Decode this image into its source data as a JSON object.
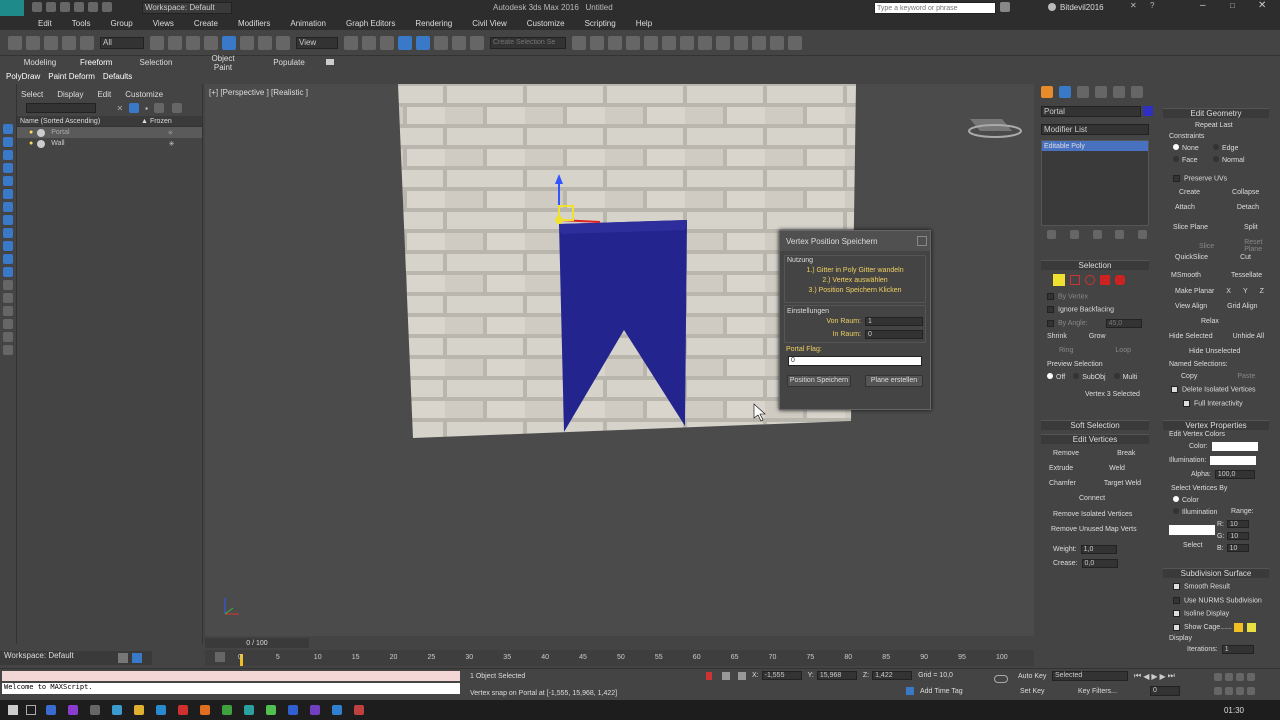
{
  "title_bar": {
    "workspace": "Workspace: Default",
    "app_title": "Autodesk 3ds Max 2016",
    "doc_title": "Untitled",
    "search_placeholder": "Type a keyword or phrase",
    "user": "Bitdevil2016"
  },
  "menu": [
    "Edit",
    "Tools",
    "Group",
    "Views",
    "Create",
    "Modifiers",
    "Animation",
    "Graph Editors",
    "Rendering",
    "Civil View",
    "Customize",
    "Scripting",
    "Help"
  ],
  "toolbar": {
    "filter_value": "All",
    "refcoord_value": "View",
    "selection_set_placeholder": "Create Selection Se"
  },
  "ribbon": {
    "tabs": [
      "Modeling",
      "Freeform",
      "Selection",
      "Object Paint",
      "Populate"
    ],
    "subtabs": [
      "PolyDraw",
      "Paint Deform",
      "Defaults"
    ]
  },
  "scene_explorer": {
    "menu": [
      "Select",
      "Display",
      "Edit",
      "Customize"
    ],
    "col_name": "Name (Sorted Ascending)",
    "col_frozen": "Frozen",
    "items": [
      {
        "name": "Portal",
        "selected": true
      },
      {
        "name": "Wall",
        "selected": false
      }
    ]
  },
  "viewport": {
    "label": "[+] [Perspective ] [Realistic ]"
  },
  "dialog": {
    "title": "Vertex Position Speichern",
    "group1": "Nutzung",
    "steps": [
      "1.) Gitter in Poly Gitter wandeln",
      "2.) Vertex auswählen",
      "3.) Position Speichern Klicken"
    ],
    "group2": "Einstellungen",
    "von_raum_label": "Von Raum:",
    "von_raum_value": "1",
    "in_raum_label": "In Raum:",
    "in_raum_value": "0",
    "portal_flag_label": "Portal Flag:",
    "portal_flag_value": "0",
    "btn_save": "Position Speichern",
    "btn_plane": "Plane erstellen"
  },
  "command_panel": {
    "object_name": "Portal",
    "modifier_list": "Modifier List",
    "stack_item": "Editable Poly",
    "selection_title": "Selection",
    "by_vertex": "By Vertex",
    "ignore_backfacing": "Ignore Backfacing",
    "by_angle": "By Angle:",
    "by_angle_value": "45,0",
    "shrink": "Shrink",
    "grow": "Grow",
    "ring": "Ring",
    "loop": "Loop",
    "preview_selection": "Preview Selection",
    "preview_opts": [
      "Off",
      "SubObj",
      "Multi"
    ],
    "selected_status": "Vertex 3 Selected",
    "soft_selection": "Soft Selection",
    "edit_vertices": "Edit Vertices",
    "remove": "Remove",
    "break": "Break",
    "extrude": "Extrude",
    "weld": "Weld",
    "chamfer": "Chamfer",
    "target_weld": "Target Weld",
    "connect": "Connect",
    "remove_isolated": "Remove Isolated Vertices",
    "remove_unused": "Remove Unused Map Verts",
    "weight_label": "Weight:",
    "weight_value": "1,0",
    "crease_label": "Crease:",
    "crease_value": "0,0"
  },
  "right_panel": {
    "edit_geometry": "Edit Geometry",
    "repeat_last": "Repeat Last",
    "constraints": "Constraints",
    "constraint_opts": [
      "None",
      "Edge",
      "Face",
      "Normal"
    ],
    "preserve_uvs": "Preserve UVs",
    "create": "Create",
    "collapse": "Collapse",
    "attach": "Attach",
    "detach": "Detach",
    "slice_plane": "Slice Plane",
    "split": "Split",
    "slice": "Slice",
    "reset_plane": "Reset Plane",
    "quickslice": "QuickSlice",
    "cut": "Cut",
    "msmooth": "MSmooth",
    "tessellate": "Tessellate",
    "make_planar": "Make Planar",
    "xyz": [
      "X",
      "Y",
      "Z"
    ],
    "view_align": "View Align",
    "grid_align": "Grid Align",
    "relax": "Relax",
    "hide_selected": "Hide Selected",
    "unhide_all": "Unhide All",
    "hide_unselected": "Hide Unselected",
    "named_selections": "Named Selections:",
    "copy": "Copy",
    "paste": "Paste",
    "delete_isolated": "Delete Isolated Vertices",
    "full_interactivity": "Full Interactivity",
    "vertex_properties": "Vertex Properties",
    "edit_vertex_colors": "Edit Vertex Colors",
    "color_label": "Color:",
    "illum_label": "Illumination:",
    "alpha_label": "Alpha:",
    "alpha_value": "100,0",
    "select_by": "Select Vertices By",
    "sel_color": "Color",
    "sel_illum": "Illumination",
    "range": "Range:",
    "r": "R:",
    "g": "G:",
    "b": "B:",
    "range_value": "10",
    "select": "Select",
    "subdivision_surface": "Subdivision Surface",
    "smooth_result": "Smooth Result",
    "use_nurms": "Use NURMS Subdivision",
    "isoline_display": "Isoline Display",
    "show_cage": "Show Cage......",
    "display": "Display",
    "iterations_label": "Iterations:",
    "iterations_value": "1"
  },
  "timeline": {
    "frame_label": "0 / 100",
    "ticks": [
      "0",
      "5",
      "10",
      "15",
      "20",
      "25",
      "30",
      "35",
      "40",
      "45",
      "50",
      "55",
      "60",
      "65",
      "70",
      "75",
      "80",
      "85",
      "90",
      "95",
      "100"
    ]
  },
  "status": {
    "workspace": "Workspace: Default",
    "maxscript": "Welcome to MAXScript.",
    "selected": "1 Object Selected",
    "snap": "Vertex snap on Portal at [-1,555, 15,968, 1,422]",
    "x_label": "X:",
    "x_value": "-1,555",
    "y_label": "Y:",
    "y_value": "15,968",
    "z_label": "Z:",
    "z_value": "1,422",
    "grid": "Grid = 10,0",
    "add_time_tag": "Add Time Tag",
    "auto_key": "Auto Key",
    "set_key": "Set Key",
    "key_mode": "Selected",
    "key_filters": "Key Filters...",
    "frame": "0"
  },
  "taskbar": {
    "time": "01:30"
  }
}
